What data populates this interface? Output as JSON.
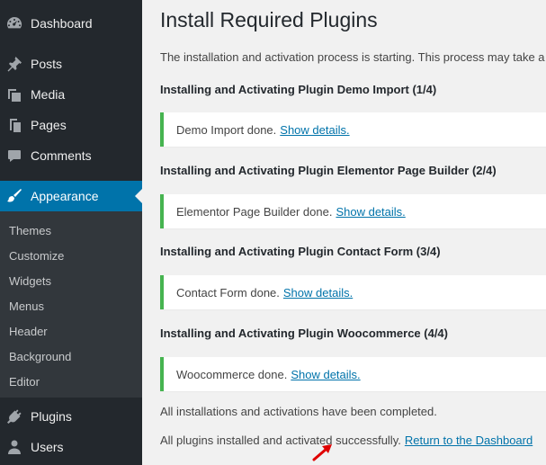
{
  "sidebar": {
    "items": [
      {
        "label": "Dashboard",
        "icon": "dashboard-icon"
      },
      {
        "label": "Posts",
        "icon": "pin-icon"
      },
      {
        "label": "Media",
        "icon": "media-icon"
      },
      {
        "label": "Pages",
        "icon": "pages-icon"
      },
      {
        "label": "Comments",
        "icon": "comment-icon"
      },
      {
        "label": "Appearance",
        "icon": "paintbrush-icon",
        "active": true
      },
      {
        "label": "Plugins",
        "icon": "plugin-icon"
      },
      {
        "label": "Users",
        "icon": "user-icon"
      }
    ],
    "submenu": [
      "Themes",
      "Customize",
      "Widgets",
      "Menus",
      "Header",
      "Background",
      "Editor"
    ]
  },
  "main": {
    "title": "Install Required Plugins",
    "intro": "The installation and activation process is starting. This process may take a w",
    "steps": [
      {
        "heading": "Installing and Activating Plugin Demo Import (1/4)",
        "notice": "Demo Import done.",
        "link": "Show details."
      },
      {
        "heading": "Installing and Activating Plugin Elementor Page Builder (2/4)",
        "notice": "Elementor Page Builder done.",
        "link": "Show details."
      },
      {
        "heading": "Installing and Activating Plugin Contact Form (3/4)",
        "notice": "Contact Form done.",
        "link": "Show details."
      },
      {
        "heading": "Installing and Activating Plugin Woocommerce (4/4)",
        "notice": "Woocommerce done.",
        "link": "Show details."
      }
    ],
    "completed": "All installations and activations have been completed.",
    "success": "All plugins installed and activated successfully.",
    "return_link": "Return to the Dashboard"
  },
  "colors": {
    "sidebar_bg": "#23282d",
    "submenu_bg": "#32373c",
    "active_bg": "#0073aa",
    "success_border": "#46b450",
    "link": "#0073aa",
    "annotation_arrow": "#e00000"
  }
}
